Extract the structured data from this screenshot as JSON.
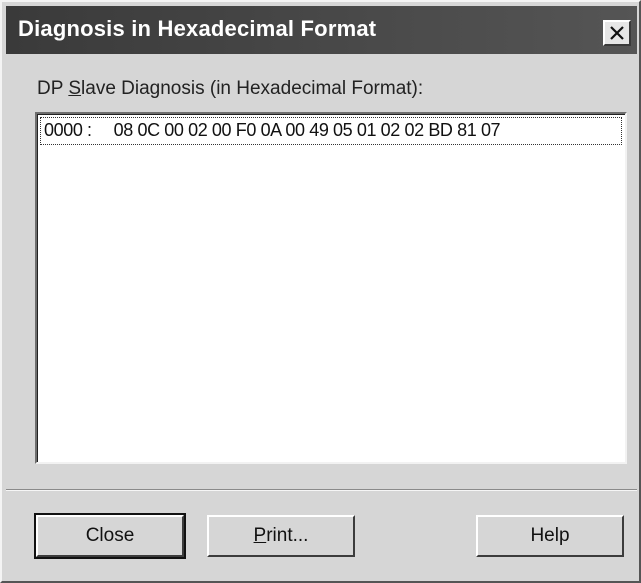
{
  "window": {
    "title": "Diagnosis in Hexadecimal Format",
    "close_icon": "close-icon"
  },
  "field": {
    "label_prefix": "DP ",
    "label_accel": "S",
    "label_rest": "lave Diagnosis (in Hexadecimal Format):"
  },
  "list": {
    "rows": [
      {
        "address": "0000 :",
        "bytes": "08 0C 00 02 00 F0 0A 00 49 05 01 02 02 BD 81 07"
      }
    ]
  },
  "buttons": {
    "close_label": "Close",
    "print_accel": "P",
    "print_rest": "rint...",
    "help_label": "Help"
  },
  "colors": {
    "titlebar": "#3a3a3a",
    "face": "#d6d6d6",
    "list_bg": "#ffffff"
  }
}
